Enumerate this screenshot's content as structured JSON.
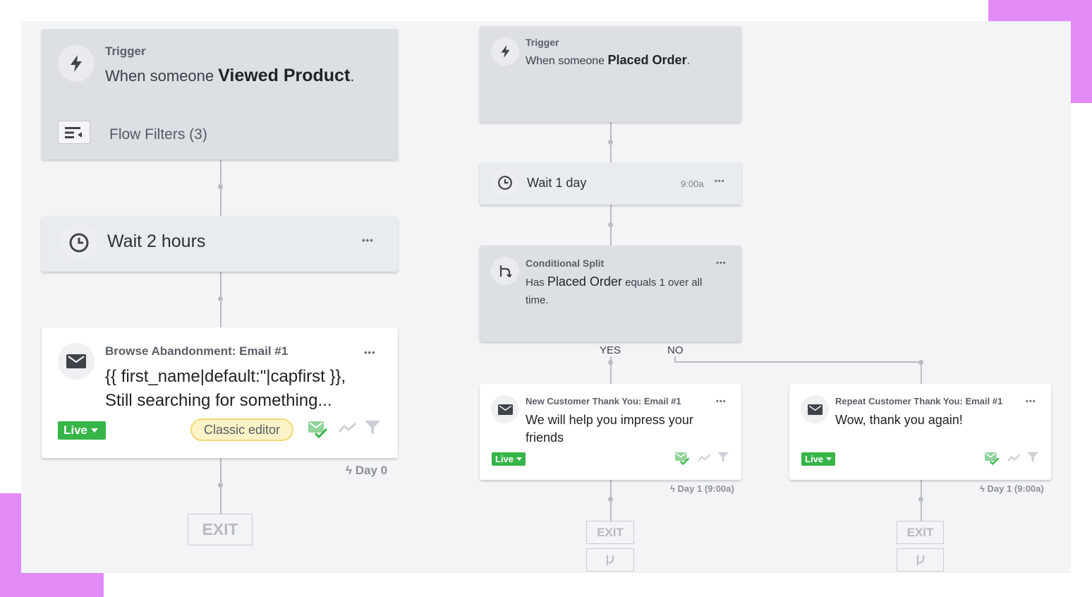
{
  "left_flow": {
    "trigger": {
      "label": "Trigger",
      "prefix": "When someone ",
      "event": "Viewed Product",
      "suffix": ".",
      "filters": "Flow Filters (3)"
    },
    "wait": {
      "text": "Wait 2 hours",
      "more": "•••"
    },
    "email": {
      "title": "Browse Abandonment: Email #1",
      "line1": "{{ first_name|default:\"|capfirst }},",
      "line2": "Still searching for something...",
      "status": "Live",
      "editor": "Classic editor",
      "more": "•••",
      "day": "Day 0"
    },
    "exit": "EXIT"
  },
  "right_flow": {
    "trigger": {
      "label": "Trigger",
      "prefix": "When someone ",
      "event": "Placed Order",
      "suffix": "."
    },
    "wait": {
      "text": "Wait 1 day",
      "time": "9:00a",
      "more": "•••"
    },
    "split": {
      "label": "Conditional Split",
      "line_prefix": "Has ",
      "line_event": "Placed Order",
      "line_suffix": " equals 1 over all",
      "line2": "time.",
      "more": "•••",
      "yes": "YES",
      "no": "NO"
    },
    "email_yes": {
      "title": "New Customer Thank You: Email #1",
      "line1": "We will help you impress your",
      "line2": "friends",
      "status": "Live",
      "more": "•••",
      "day": "Day 1 (9:00a)"
    },
    "email_no": {
      "title": "Repeat Customer Thank You: Email #1",
      "line1": "Wow, thank you again!",
      "status": "Live",
      "more": "•••",
      "day": "Day 1 (9:00a)"
    },
    "exit": "EXIT"
  },
  "colors": {
    "accent": "#e28af5",
    "live": "#36b548",
    "editor_badge": "#fcf3c6"
  }
}
